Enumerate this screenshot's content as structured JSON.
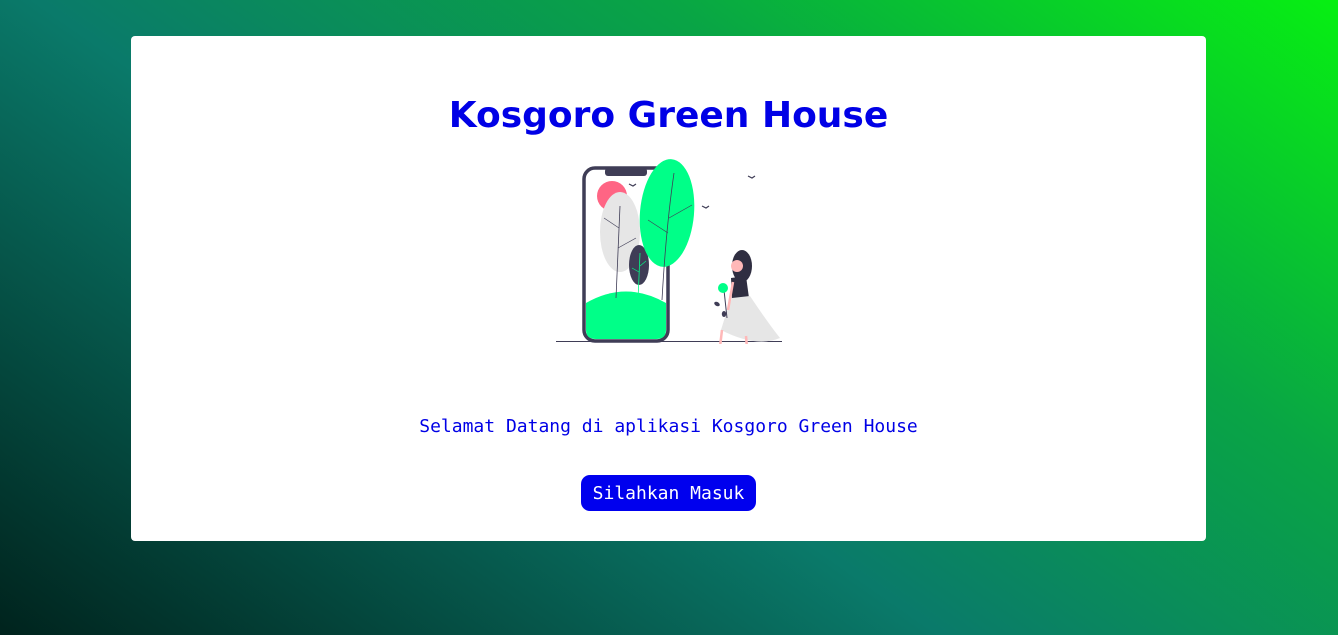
{
  "page": {
    "title": "Kosgoro Green House",
    "illustration_icon": "phone-plant-woman-illustration",
    "welcome_text": "Selamat Datang di aplikasi Kosgoro Green House",
    "enter_button_label": "Silahkan Masuk"
  },
  "colors": {
    "accent": "#0000e6",
    "button": "#0000ee",
    "plant_green": "#00ff88",
    "sun_pink": "#ff6584",
    "dark": "#3f3d56"
  }
}
